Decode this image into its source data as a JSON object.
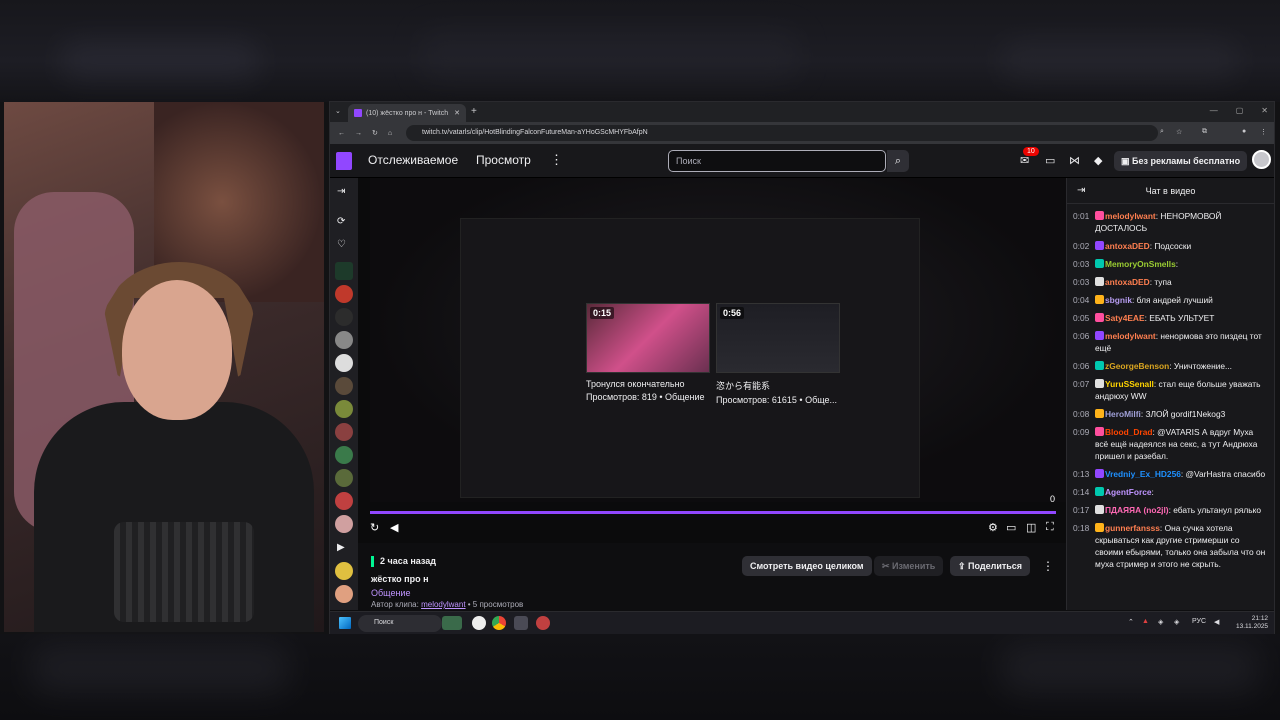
{
  "browser": {
    "tab_title": "(10) жёстко про н - Twitch",
    "url": "twitch.tv/vatarls/clip/HotBlindingFalconFutureMan-aYHoGScMHYFbAfpN"
  },
  "nav": {
    "following": "Отслеживаемое",
    "browse": "Просмотр",
    "search_placeholder": "Поиск",
    "notif_count": "10",
    "no_ads": "Без рекламы бесплатно"
  },
  "player": {
    "time_left": "0",
    "accent": "#9147ff",
    "cards": [
      {
        "duration": "0:15",
        "title": "Тронулся окончательно",
        "meta": "Просмотров: 819 • Общение"
      },
      {
        "duration": "0:56",
        "title": "恣から有能系",
        "meta": "Просмотров: 61615 • Обще..."
      }
    ]
  },
  "clip": {
    "ago": "2 часа назад",
    "title": "жёстко про н",
    "category": "Общение",
    "author_label": "Автор клипа:",
    "author": "melodylwant",
    "views": "• 5 просмотров",
    "watch_full": "Смотреть видео целиком",
    "edit": "Изменить",
    "share": "Поделиться"
  },
  "chat": {
    "title": "Чат в видео",
    "messages": [
      {
        "t": "0:01",
        "user": "melodylwant",
        "color": "#ff7f50",
        "text": "НЕНОРМОВОЙ ДОСТАЛОСЬ"
      },
      {
        "t": "0:02",
        "user": "antoxaDED",
        "color": "#ff7f50",
        "text": "Подсоски"
      },
      {
        "t": "0:03",
        "user": "MemoryOnSmells",
        "color": "#9acd32",
        "text": ""
      },
      {
        "t": "0:03",
        "user": "antoxaDED",
        "color": "#ff7f50",
        "text": "тупа"
      },
      {
        "t": "0:04",
        "user": "sbgnik",
        "color": "#b69cf0",
        "text": "бля андрей лучший"
      },
      {
        "t": "0:05",
        "user": "Saty4EAE",
        "color": "#ff7f50",
        "text": "ЕБАТЬ УЛЬТУЕТ"
      },
      {
        "t": "0:06",
        "user": "melodylwant",
        "color": "#ff7f50",
        "text": "ненормова это пиздец тот ещё"
      },
      {
        "t": "0:06",
        "user": "zGeorgeBenson",
        "color": "#daa520",
        "text": "Уничтожение..."
      },
      {
        "t": "0:07",
        "user": "YuruSSenall",
        "color": "#ffd400",
        "text": "стал еще больше уважать андрюху WW"
      },
      {
        "t": "0:08",
        "user": "HeroMilfi",
        "color": "#a0a0d8",
        "text": "ЗЛОЙ gordif1Nekog3"
      },
      {
        "t": "0:09",
        "user": "Blood_Drad",
        "color": "#ff4500",
        "text": "@VATARIS А вдруг Муха всё ещё надеялся на секс, а тут Андрюха пришел и разебал."
      },
      {
        "t": "0:13",
        "user": "Vredniy_Ex_HD256",
        "color": "#1e90ff",
        "text": "@VarHastra спасибо"
      },
      {
        "t": "0:14",
        "user": "AgentForce",
        "color": "#bf94ff",
        "text": ""
      },
      {
        "t": "0:17",
        "user": "ПДАЯЯА (no2jl)",
        "color": "#ff69b4",
        "text": "ебать ультанул рялько"
      },
      {
        "t": "0:18",
        "user": "gunnerfansss",
        "color": "#ff7f50",
        "text": "Она сучка хотела скрываться как другие стримерши со своими ебырями, только она забыла что он муха стример и этого не скрыть."
      }
    ]
  },
  "taskbar": {
    "search": "Поиск",
    "lang": "РУС",
    "time": "21:12",
    "date": "13.11.2025"
  }
}
